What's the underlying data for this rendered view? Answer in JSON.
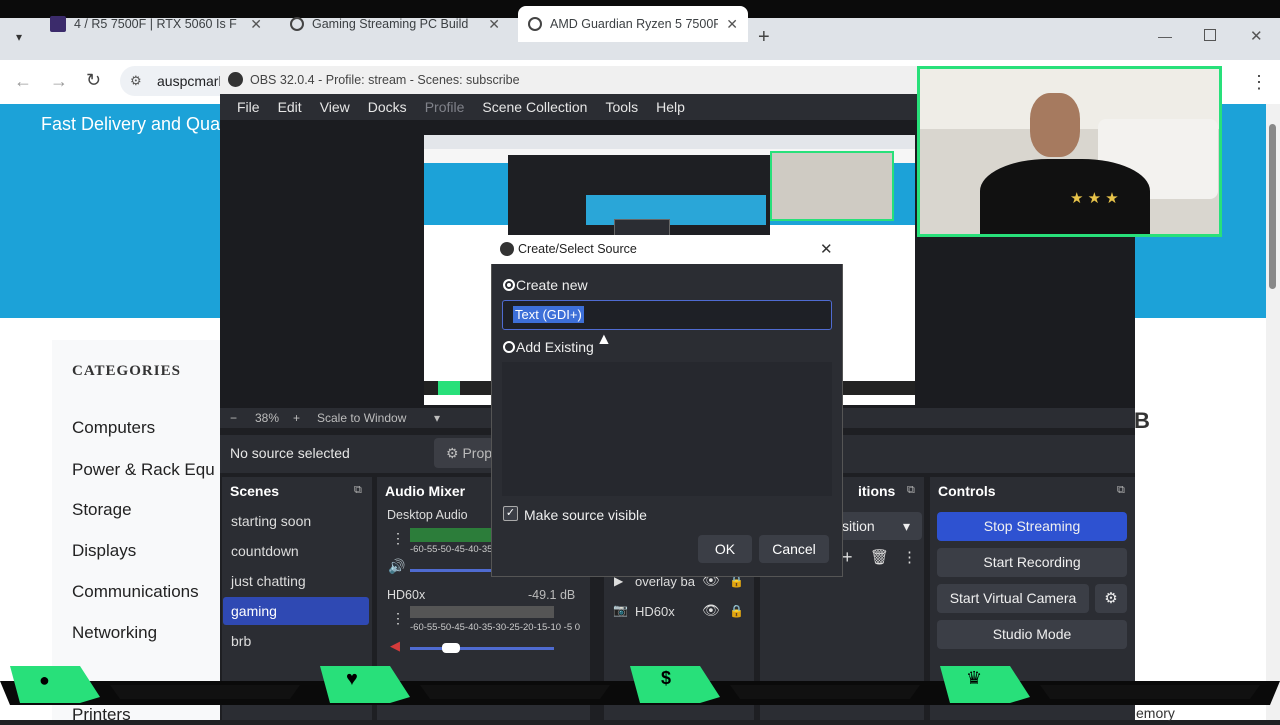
{
  "browser": {
    "tabs": [
      {
        "title": "4 / R5 7500F | RTX 5060 Is F"
      },
      {
        "title": "Gaming Streaming PC Build"
      },
      {
        "title": "AMD Guardian Ryzen 5 7500F R"
      }
    ],
    "url": "auspcmark"
  },
  "site": {
    "hero_text": "Fast Delivery and Qua",
    "categories_title": "CATEGORIES",
    "categories": [
      "Computers",
      "Power & Rack Equ",
      "Storage",
      "Displays",
      "Communications",
      "Networking",
      "Printers"
    ],
    "right_partial": "B",
    "right_bottom_partial": "emory"
  },
  "obs": {
    "title": "OBS 32.0.4 - Profile: stream - Scenes: subscribe",
    "menu": [
      "File",
      "Edit",
      "View",
      "Docks",
      "Profile",
      "Scene Collection",
      "Tools",
      "Help"
    ],
    "zoom": "38%",
    "scale_mode": "Scale to Window",
    "no_source": "No source selected",
    "properties_btn": "Prop",
    "docks": {
      "scenes_title": "Scenes",
      "mixer_title": "Audio Mixer",
      "transitions_title": "itions",
      "controls_title": "Controls"
    },
    "scenes": [
      "starting soon",
      "countdown",
      "just chatting",
      "gaming",
      "brb"
    ],
    "mixer": {
      "ch1": "Desktop Audio",
      "ch2": "HD60x",
      "ch2_db": "-49.1 dB",
      "ticks": "-60-55-50-45-40-35-30-25-20-15-10 -5  0",
      "ticks_short": "-60-55-50-45-40-35-"
    },
    "sources": [
      "overlay ba",
      "HD60x"
    ],
    "transition_value": "sition",
    "controls": [
      "Stop Streaming",
      "Start Recording",
      "Start Virtual Camera",
      "Studio Mode"
    ]
  },
  "dialog": {
    "title": "Create/Select Source",
    "create_new": "Create new",
    "name_value": "Text (GDI+)",
    "add_existing": "Add Existing",
    "make_visible": "Make source visible",
    "ok": "OK",
    "cancel": "Cancel"
  },
  "overlay": {
    "accent": "#28e07a"
  }
}
